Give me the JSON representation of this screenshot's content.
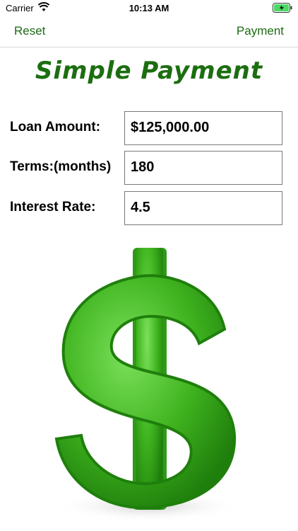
{
  "status": {
    "carrier": "Carrier",
    "time": "10:13 AM"
  },
  "nav": {
    "left_label": "Reset",
    "right_label": "Payment"
  },
  "title": "Simple Payment",
  "form": {
    "loan_amount": {
      "label": "Loan Amount:",
      "value": "$125,000.00"
    },
    "terms": {
      "label": "Terms:(months)",
      "value": "180"
    },
    "interest_rate": {
      "label": "Interest Rate:",
      "value": "4.5"
    }
  },
  "colors": {
    "accent": "#1d6b14",
    "title": "#1c6e10",
    "dollar_green": "#3fb31f"
  },
  "icons": [
    "wifi-icon",
    "battery-icon",
    "dollar-sign-icon"
  ]
}
